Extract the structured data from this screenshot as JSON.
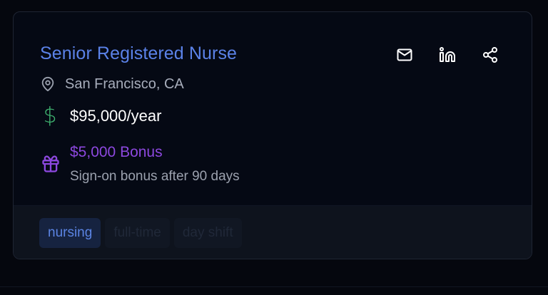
{
  "job": {
    "title": "Senior Registered Nurse",
    "location": "San Francisco, CA",
    "salary": "$95,000/year",
    "currency_symbol": "$",
    "bonus": {
      "title": "$5,000 Bonus",
      "description": "Sign-on bonus after 90 days"
    },
    "tags": [
      "nursing",
      "full-time",
      "day shift"
    ]
  },
  "actions": {
    "email_icon": "mail-icon",
    "linkedin_icon": "linkedin-icon",
    "share_icon": "share-icon"
  },
  "colors": {
    "background": "#05070e",
    "card": "#050914",
    "title": "#5b82e8",
    "salary_icon": "#3fb370",
    "bonus": "#8d48df",
    "tag_active_bg": "#162340"
  }
}
